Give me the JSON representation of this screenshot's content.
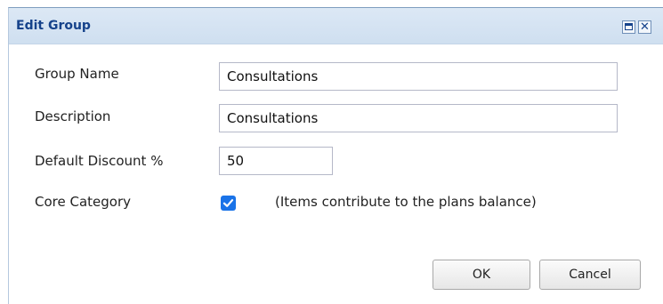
{
  "window": {
    "title": "Edit Group",
    "maximize_icon": "maximize-icon",
    "close_icon": "close-icon",
    "close_glyph": "✕"
  },
  "form": {
    "group_name": {
      "label": "Group Name",
      "value": "Consultations"
    },
    "description": {
      "label": "Description",
      "value": "Consultations"
    },
    "default_discount": {
      "label": "Default Discount %",
      "value": "50"
    },
    "core_category": {
      "label": "Core Category",
      "checked": true,
      "note": "(Items contribute to the plans balance)"
    }
  },
  "buttons": {
    "ok_label": "OK",
    "cancel_label": "Cancel"
  },
  "colors": {
    "title_text": "#15428b",
    "titlebar_bg": "#d6e3f2",
    "checkbox_accent": "#1a73e8"
  }
}
